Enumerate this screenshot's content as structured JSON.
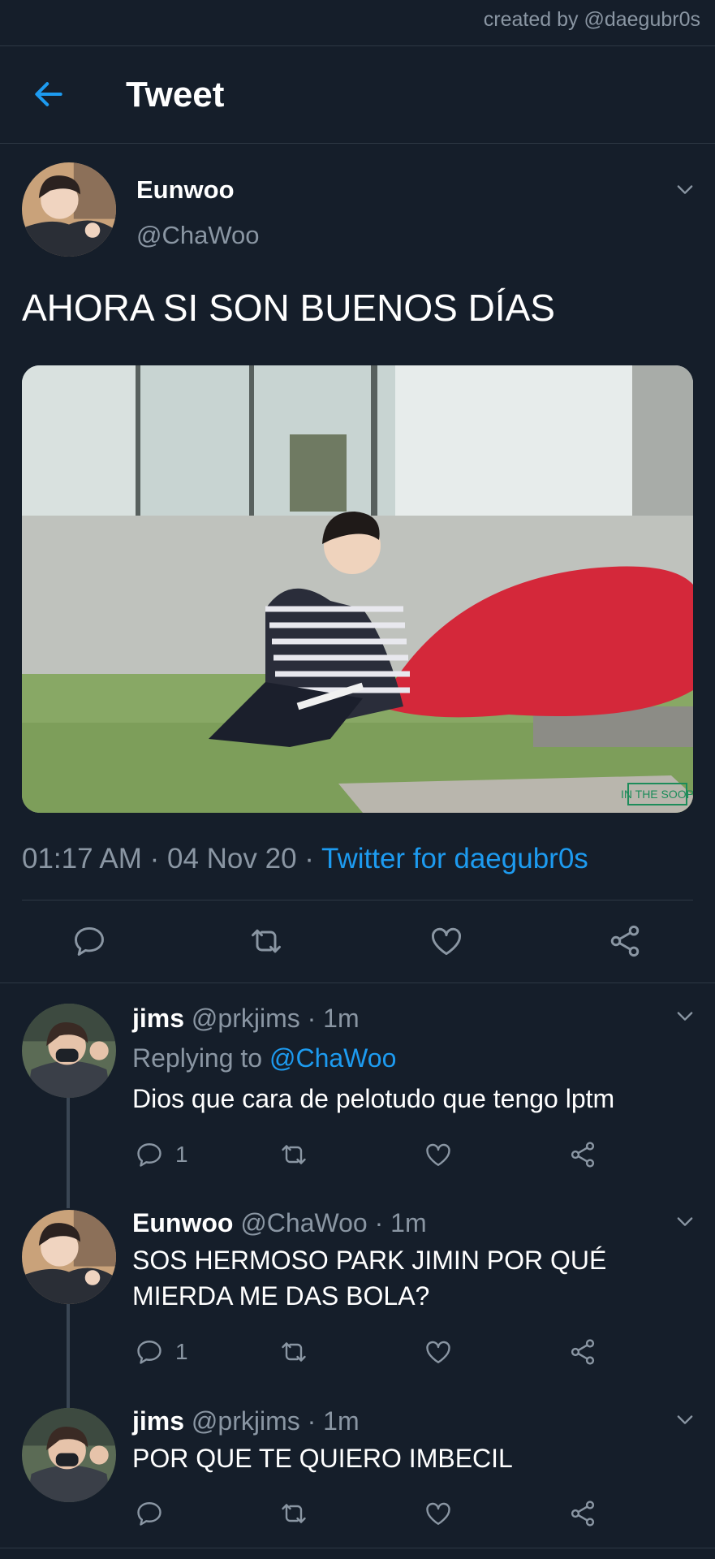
{
  "watermark": "created by @daegubr0s",
  "header": {
    "title": "Tweet"
  },
  "tweet": {
    "name": "Eunwoo",
    "handle": "@ChaWoo",
    "text": "AHORA SI SON BUENOS DÍAS",
    "photo_watermark": "IN THE SOOP",
    "time": "01:17 AM · 04 Nov 20 · ",
    "source": "Twitter for daegubr0s"
  },
  "replies": [
    {
      "name": "jims",
      "handle_time": " @prkjims · 1m",
      "replying_prefix": "Replying to ",
      "replying_to": "@ChaWoo",
      "text": "Dios que cara de pelotudo que tengo lptm",
      "reply_count": "1"
    },
    {
      "name": "Eunwoo",
      "handle_time": " @ChaWoo · 1m",
      "text_line1": "SOS HERMOSO PARK JIMIN POR QUÉ",
      "text_line2": "MIERDA ME DAS BOLA?",
      "reply_count": "1"
    },
    {
      "name": "jims",
      "handle_time": " @prkjims · 1m",
      "text": "POR QUE TE QUIERO IMBECIL"
    }
  ],
  "colors": {
    "background": "#151e2a",
    "accent": "#1d9bf0",
    "muted": "#8a96a3",
    "divider": "#2d3844"
  },
  "icons": [
    "back-arrow-icon",
    "chevron-down-icon",
    "reply-icon",
    "retweet-icon",
    "like-icon",
    "share-icon"
  ]
}
